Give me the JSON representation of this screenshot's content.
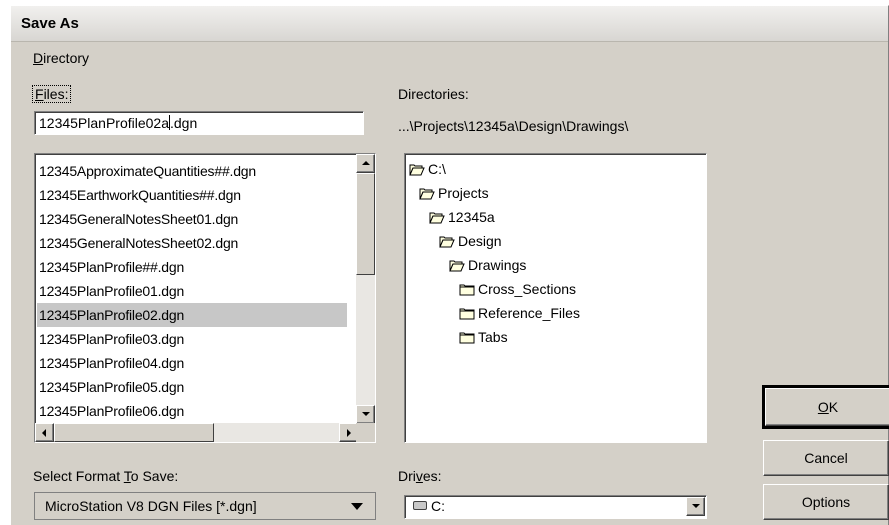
{
  "window": {
    "title": "Save As"
  },
  "menu": {
    "directory_prefix": "D",
    "directory_rest": "irectory"
  },
  "files": {
    "label_prefix": "F",
    "label_rest": "iles:",
    "input_before_caret": "12345PlanProfile02a",
    "input_after_caret": ".dgn",
    "items": [
      "12345ApproximateQuantities##.dgn",
      "12345EarthworkQuantities##.dgn",
      "12345GeneralNotesSheet01.dgn",
      "12345GeneralNotesSheet02.dgn",
      "12345PlanProfile##.dgn",
      "12345PlanProfile01.dgn",
      "12345PlanProfile02.dgn",
      "12345PlanProfile03.dgn",
      "12345PlanProfile04.dgn",
      "12345PlanProfile05.dgn",
      "12345PlanProfile06.dgn"
    ],
    "selected_index": 6
  },
  "directories": {
    "label": "Directories:",
    "current_path": "...\\Projects\\12345a\\Design\\Drawings\\",
    "tree": [
      {
        "name": "C:\\",
        "icon": "open-folder-icon",
        "level": 0
      },
      {
        "name": "Projects",
        "icon": "open-folder-icon",
        "level": 1
      },
      {
        "name": "12345a",
        "icon": "open-folder-icon",
        "level": 2
      },
      {
        "name": "Design",
        "icon": "open-folder-icon",
        "level": 3
      },
      {
        "name": "Drawings",
        "icon": "open-folder-icon",
        "level": 4
      },
      {
        "name": "Cross_Sections",
        "icon": "folder-icon",
        "level": 5
      },
      {
        "name": "Reference_Files",
        "icon": "folder-icon",
        "level": 5
      },
      {
        "name": "Tabs",
        "icon": "folder-icon",
        "level": 5
      }
    ]
  },
  "format": {
    "label_before": "Select Format ",
    "label_underlined": "T",
    "label_after": "o Save:",
    "selected": "MicroStation V8 DGN Files [*.dgn]"
  },
  "drives": {
    "label_before": "Dri",
    "label_underlined": "v",
    "label_after": "es:",
    "selected": "C:"
  },
  "buttons": {
    "ok_underlined": "O",
    "ok_rest": "K",
    "cancel": "Cancel",
    "options": "Options"
  },
  "colors": {
    "dialog_bg": "#d4d0c8",
    "selection_bg": "#c7c7c7",
    "folder_fill": "#ffffe0"
  }
}
